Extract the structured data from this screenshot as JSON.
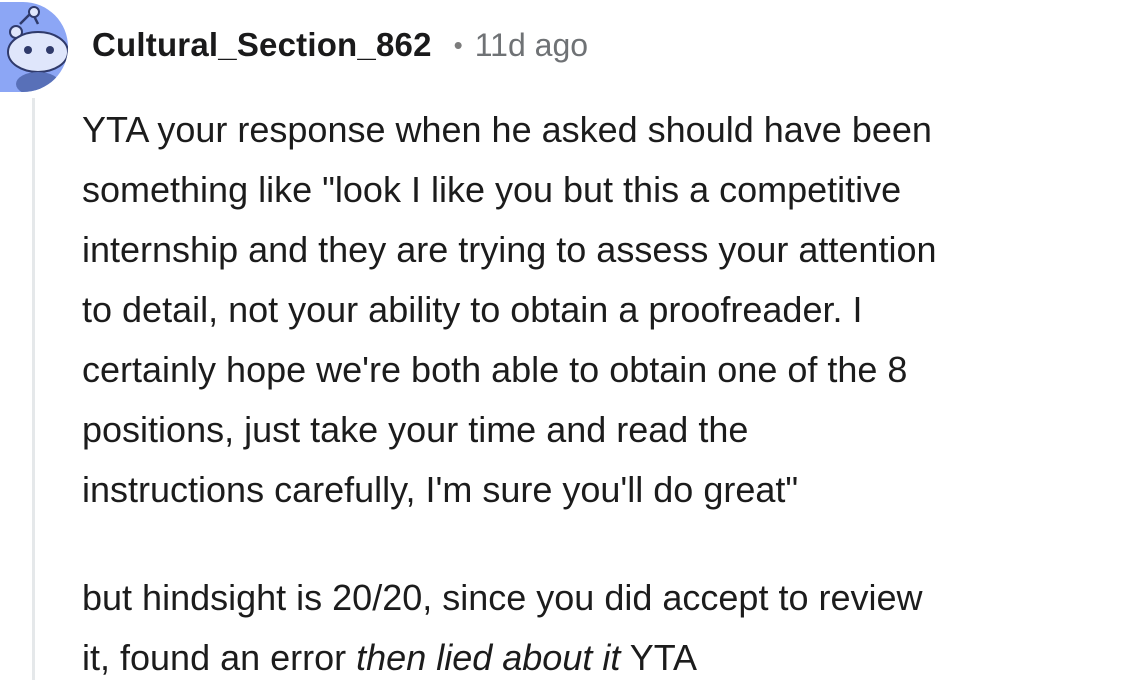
{
  "comment": {
    "username": "Cultural_Section_862",
    "separator": "•",
    "timestamp": "11d ago",
    "paragraph1_lines": [
      "YTA your response when he asked should have been",
      "something like \"look I like you but this a competitive",
      "internship and they are trying to assess your attention",
      "to detail, not your ability to obtain a proofreader. I",
      "certainly hope we're both able to obtain one of the 8",
      "positions, just take your time and read the",
      "instructions carefully, I'm sure you'll do great\""
    ],
    "paragraph2": {
      "line1": "but hindsight is 20/20, since you did accept to review",
      "line2_prefix": "it, found an error ",
      "line2_italic": "then lied about it",
      "line2_suffix": " YTA"
    }
  },
  "colors": {
    "avatar_bg": "#8ca6f5",
    "thread_line": "#e5e8ea",
    "username": "#1a1a1b",
    "timestamp": "#6f7275",
    "body_text": "#1c1c1c"
  },
  "icons": {
    "avatar": "reddit-snoo-avatar-icon"
  }
}
